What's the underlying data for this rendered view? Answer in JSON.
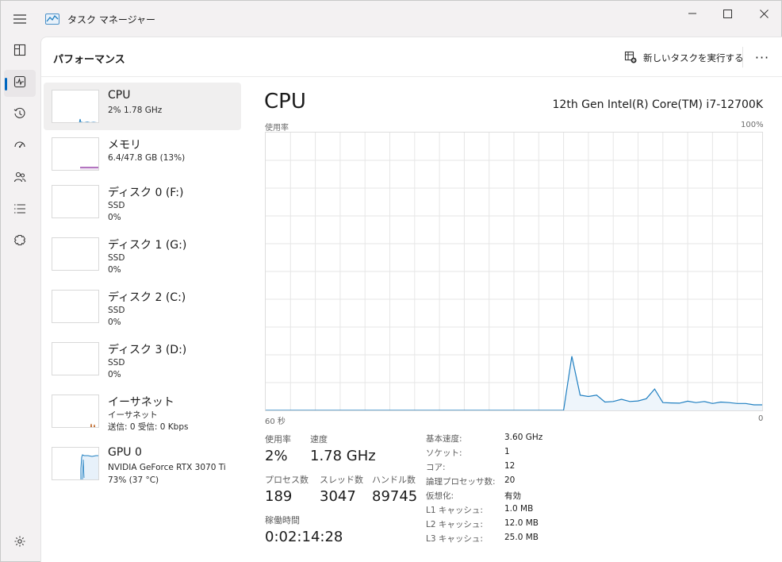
{
  "window": {
    "title": "タスク マネージャー"
  },
  "header": {
    "page_title": "パフォーマンス",
    "run_task_label": "新しいタスクを実行する",
    "more_label": "···"
  },
  "nav": {
    "icons": [
      "processes-icon",
      "performance-icon",
      "app-history-icon",
      "startup-apps-icon",
      "users-icon",
      "details-icon",
      "services-icon",
      "settings-icon"
    ]
  },
  "resources": [
    {
      "name": "CPU",
      "line1": "2%  1.78 GHz",
      "line2": ""
    },
    {
      "name": "メモリ",
      "line1": "6.4/47.8 GB (13%)",
      "line2": ""
    },
    {
      "name": "ディスク 0 (F:)",
      "line1": "SSD",
      "line2": "0%"
    },
    {
      "name": "ディスク 1 (G:)",
      "line1": "SSD",
      "line2": "0%"
    },
    {
      "name": "ディスク 2 (C:)",
      "line1": "SSD",
      "line2": "0%"
    },
    {
      "name": "ディスク 3 (D:)",
      "line1": "SSD",
      "line2": "0%"
    },
    {
      "name": "イーサネット",
      "line1": "イーサネット",
      "line2": "送信: 0 受信: 0 Kbps"
    },
    {
      "name": "GPU 0",
      "line1": "NVIDIA GeForce RTX 3070 Ti",
      "line2": "73% (37 °C)"
    }
  ],
  "detail": {
    "title": "CPU",
    "model": "12th Gen Intel(R) Core(TM) i7-12700K",
    "graph_top_left": "使用率",
    "graph_top_right": "100%",
    "graph_bottom_left": "60 秒",
    "graph_bottom_right": "0",
    "stats": {
      "usage_label": "使用率",
      "usage_value": "2%",
      "speed_label": "速度",
      "speed_value": "1.78 GHz",
      "processes_label": "プロセス数",
      "processes_value": "189",
      "threads_label": "スレッド数",
      "threads_value": "3047",
      "handles_label": "ハンドル数",
      "handles_value": "89745",
      "uptime_label": "稼働時間",
      "uptime_value": "0:02:14:28"
    },
    "specs": [
      {
        "label": "基本速度:",
        "value": "3.60 GHz"
      },
      {
        "label": "ソケット:",
        "value": "1"
      },
      {
        "label": "コア:",
        "value": "12"
      },
      {
        "label": "論理プロセッサ数:",
        "value": "20"
      },
      {
        "label": "仮想化:",
        "value": "有効"
      },
      {
        "label": "L1 キャッシュ:",
        "value": "1.0 MB"
      },
      {
        "label": "L2 キャッシュ:",
        "value": "12.0 MB"
      },
      {
        "label": "L3 キャッシュ:",
        "value": "25.0 MB"
      }
    ]
  },
  "chart_data": {
    "type": "area",
    "x": [
      60,
      59,
      58,
      57,
      56,
      55,
      54,
      53,
      52,
      51,
      50,
      49,
      48,
      47,
      46,
      45,
      44,
      43,
      42,
      41,
      40,
      39,
      38,
      37,
      36,
      35,
      34,
      33,
      32,
      31,
      30,
      29,
      28,
      27,
      26,
      25,
      24,
      23,
      22,
      21,
      20,
      19,
      18,
      17,
      16,
      15,
      14,
      13,
      12,
      11,
      10,
      9,
      8,
      7,
      6,
      5,
      4,
      3,
      2,
      1,
      0
    ],
    "values": [
      0,
      0,
      0,
      0,
      0,
      0,
      0,
      0,
      0,
      0,
      0,
      0,
      0,
      0,
      0,
      0,
      0,
      0,
      0,
      0,
      0,
      0,
      0,
      0,
      0,
      0,
      0,
      0,
      0,
      0,
      0,
      0,
      0,
      0,
      0,
      0,
      0,
      19.5,
      5.5,
      5,
      5.5,
      3,
      3.2,
      4,
      3.2,
      3.4,
      4.2,
      7.7,
      2.8,
      2.7,
      2.6,
      3.3,
      2.8,
      3.2,
      2.5,
      3,
      2.8,
      2.5,
      2.5,
      2,
      2
    ],
    "xlim": [
      60,
      0
    ],
    "ylim": [
      0,
      100
    ],
    "grid": true,
    "colors": {
      "line": "#1f7fc1",
      "fill": "#eef5fb",
      "grid": "#e6e6e6"
    }
  }
}
